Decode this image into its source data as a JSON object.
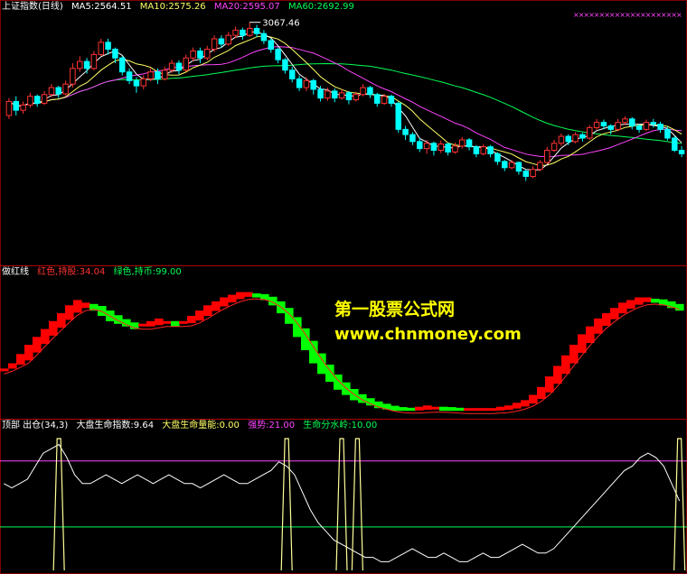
{
  "panels": {
    "main": {
      "legend": {
        "name": "上证指数(日线)",
        "ma5": "MA5:2564.51",
        "ma10": "MA10:2575.26",
        "ma20": "MA20:2595.07",
        "ma60": "MA60:2692.99"
      },
      "peak_label": "3067.46",
      "colors": {
        "up": "#ff3232",
        "down": "#00ffff",
        "ma5": "#ffffff",
        "ma10": "#ffff66",
        "ma20": "#ff44ff",
        "ma60": "#00ff55"
      }
    },
    "middle": {
      "legend": {
        "name": "做红线",
        "red": "红色,持股:34.04",
        "green": "绿色,持币:99.00"
      },
      "colors": {
        "red": "#ff0000",
        "green": "#00ff00",
        "redline": "#ff2222"
      }
    },
    "bottom": {
      "legend": {
        "name": "顶部 出仓(34,3)",
        "life": "大盘生命指数:9.64",
        "energy": "大盘生命量能:0.00",
        "strong": "强势:21.00",
        "watershed": "生命分水岭:10.00"
      },
      "colors": {
        "life": "#ffffff",
        "spike": "#ffff99",
        "strong": "#ff44ff",
        "watershed": "#00ff55"
      }
    }
  },
  "watermark": {
    "line1": "第一股票公式网",
    "line2": "www.chnmoney.com"
  },
  "chart_data": {
    "type": "candlestick",
    "series_name": "上证指数(日线)",
    "peak_high": 3067.46,
    "ylim": [
      2380,
      3090
    ],
    "candles": [
      [
        2800,
        2840,
        2790,
        2850
      ],
      [
        2840,
        2815,
        2800,
        2855
      ],
      [
        2815,
        2830,
        2805,
        2840
      ],
      [
        2830,
        2855,
        2822,
        2865
      ],
      [
        2855,
        2835,
        2825,
        2860
      ],
      [
        2835,
        2860,
        2830,
        2870
      ],
      [
        2860,
        2880,
        2852,
        2890
      ],
      [
        2880,
        2862,
        2850,
        2885
      ],
      [
        2862,
        2890,
        2858,
        2900
      ],
      [
        2890,
        2935,
        2880,
        2950
      ],
      [
        2935,
        2955,
        2925,
        2970
      ],
      [
        2955,
        2935,
        2920,
        2965
      ],
      [
        2935,
        2975,
        2930,
        2985
      ],
      [
        2975,
        3010,
        2970,
        3020
      ],
      [
        3010,
        2990,
        2975,
        3020
      ],
      [
        2990,
        2965,
        2950,
        2995
      ],
      [
        2965,
        2925,
        2915,
        2970
      ],
      [
        2925,
        2900,
        2890,
        2935
      ],
      [
        2900,
        2885,
        2865,
        2910
      ],
      [
        2885,
        2905,
        2875,
        2915
      ],
      [
        2905,
        2925,
        2898,
        2935
      ],
      [
        2925,
        2905,
        2890,
        2935
      ],
      [
        2905,
        2930,
        2900,
        2940
      ],
      [
        2930,
        2950,
        2922,
        2960
      ],
      [
        2950,
        2930,
        2918,
        2958
      ],
      [
        2930,
        2965,
        2926,
        2975
      ],
      [
        2965,
        2985,
        2955,
        2995
      ],
      [
        2985,
        2965,
        2950,
        2995
      ],
      [
        2965,
        2990,
        2958,
        3000
      ],
      [
        2990,
        3020,
        2982,
        3030
      ],
      [
        3020,
        3005,
        2995,
        3030
      ],
      [
        3005,
        3030,
        3000,
        3040
      ],
      [
        3030,
        3045,
        3022,
        3055
      ],
      [
        3045,
        3030,
        3018,
        3052
      ],
      [
        3030,
        3050,
        3025,
        3067
      ],
      [
        3050,
        3035,
        3025,
        3060
      ],
      [
        3035,
        3015,
        3005,
        3045
      ],
      [
        3015,
        2990,
        2980,
        3020
      ],
      [
        2990,
        2960,
        2950,
        2995
      ],
      [
        2960,
        2930,
        2920,
        2965
      ],
      [
        2930,
        2905,
        2895,
        2940
      ],
      [
        2905,
        2880,
        2870,
        2915
      ],
      [
        2880,
        2900,
        2870,
        2910
      ],
      [
        2900,
        2875,
        2860,
        2905
      ],
      [
        2875,
        2850,
        2840,
        2885
      ],
      [
        2850,
        2870,
        2842,
        2880
      ],
      [
        2870,
        2850,
        2838,
        2878
      ],
      [
        2850,
        2865,
        2845,
        2875
      ],
      [
        2865,
        2845,
        2832,
        2870
      ],
      [
        2845,
        2860,
        2840,
        2868
      ],
      [
        2860,
        2880,
        2855,
        2890
      ],
      [
        2880,
        2860,
        2850,
        2885
      ],
      [
        2860,
        2835,
        2825,
        2865
      ],
      [
        2835,
        2855,
        2830,
        2862
      ],
      [
        2855,
        2835,
        2825,
        2860
      ],
      [
        2835,
        2760,
        2750,
        2840
      ],
      [
        2760,
        2745,
        2730,
        2770
      ],
      [
        2745,
        2725,
        2715,
        2752
      ],
      [
        2725,
        2705,
        2695,
        2735
      ],
      [
        2705,
        2720,
        2690,
        2730
      ],
      [
        2720,
        2700,
        2685,
        2725
      ],
      [
        2700,
        2718,
        2692,
        2728
      ],
      [
        2718,
        2695,
        2685,
        2722
      ],
      [
        2695,
        2712,
        2690,
        2722
      ],
      [
        2712,
        2730,
        2705,
        2738
      ],
      [
        2730,
        2710,
        2700,
        2735
      ],
      [
        2710,
        2690,
        2680,
        2715
      ],
      [
        2690,
        2710,
        2685,
        2718
      ],
      [
        2710,
        2690,
        2680,
        2715
      ],
      [
        2690,
        2668,
        2658,
        2695
      ],
      [
        2668,
        2650,
        2640,
        2672
      ],
      [
        2650,
        2665,
        2645,
        2672
      ],
      [
        2665,
        2640,
        2630,
        2668
      ],
      [
        2640,
        2625,
        2612,
        2645
      ],
      [
        2625,
        2645,
        2620,
        2655
      ],
      [
        2645,
        2665,
        2640,
        2672
      ],
      [
        2665,
        2700,
        2660,
        2710
      ],
      [
        2700,
        2720,
        2695,
        2730
      ],
      [
        2720,
        2740,
        2712,
        2748
      ],
      [
        2740,
        2725,
        2715,
        2746
      ],
      [
        2725,
        2745,
        2720,
        2752
      ],
      [
        2745,
        2735,
        2725,
        2750
      ],
      [
        2735,
        2765,
        2730,
        2772
      ],
      [
        2765,
        2780,
        2758,
        2790
      ],
      [
        2780,
        2770,
        2760,
        2788
      ],
      [
        2770,
        2760,
        2745,
        2775
      ],
      [
        2760,
        2780,
        2755,
        2790
      ],
      [
        2780,
        2790,
        2772,
        2798
      ],
      [
        2790,
        2770,
        2760,
        2795
      ],
      [
        2770,
        2760,
        2750,
        2775
      ],
      [
        2760,
        2780,
        2755,
        2788
      ],
      [
        2780,
        2775,
        2765,
        2790
      ],
      [
        2775,
        2760,
        2750,
        2782
      ],
      [
        2760,
        2735,
        2728,
        2768
      ],
      [
        2735,
        2700,
        2695,
        2740
      ],
      [
        2700,
        2690,
        2680,
        2712
      ]
    ],
    "ma_values": {
      "MA5": 2564.51,
      "MA10": 2575.26,
      "MA20": 2595.07,
      "MA60": 2692.99
    },
    "indicator_red_line": {
      "label_red": "红色,持股",
      "value_red": 34.04,
      "label_green": "绿色,持币",
      "value_green": 99.0,
      "values": [
        34,
        38,
        45,
        52,
        58,
        64,
        70,
        76,
        82,
        86,
        84,
        80,
        76,
        72,
        70,
        68,
        66,
        68,
        70,
        72,
        70,
        68,
        70,
        74,
        78,
        82,
        85,
        88,
        90,
        92,
        92,
        90,
        88,
        84,
        78,
        70,
        60,
        50,
        40,
        32,
        26,
        20,
        16,
        12,
        10,
        8,
        6,
        5,
        4,
        4,
        4,
        5,
        6,
        5,
        4,
        4,
        4,
        4,
        4,
        4,
        4,
        5,
        6,
        8,
        10,
        14,
        20,
        28,
        36,
        44,
        52,
        60,
        66,
        72,
        76,
        80,
        84,
        86,
        88,
        88,
        86,
        84,
        82,
        80
      ]
    },
    "life_index": {
      "label": "大盘生命指数",
      "value": 9.64,
      "energy_label": "大盘生命量能",
      "energy": 0.0,
      "strong_label": "强势",
      "strong": 21.0,
      "watershed_label": "生命分水岭",
      "watershed": 10.0,
      "ylim": [
        0,
        32
      ],
      "values": [
        20,
        19,
        20,
        21,
        24,
        27,
        28,
        29,
        26,
        22,
        20,
        20,
        21,
        22,
        21,
        20,
        21,
        22,
        21,
        20,
        21,
        22,
        21,
        20,
        20,
        19,
        20,
        21,
        22,
        21,
        20,
        20,
        21,
        22,
        23,
        25,
        24,
        22,
        18,
        14,
        11,
        9,
        7,
        6,
        5,
        4,
        3,
        3,
        2,
        2,
        3,
        4,
        5,
        4,
        3,
        3,
        4,
        3,
        2,
        2,
        3,
        4,
        3,
        3,
        4,
        5,
        6,
        5,
        4,
        4,
        5,
        7,
        9,
        11,
        13,
        15,
        17,
        19,
        21,
        23,
        24,
        26,
        27,
        26,
        24,
        20,
        16
      ],
      "spike_positions": [
        7,
        36,
        43,
        45,
        96
      ]
    }
  }
}
